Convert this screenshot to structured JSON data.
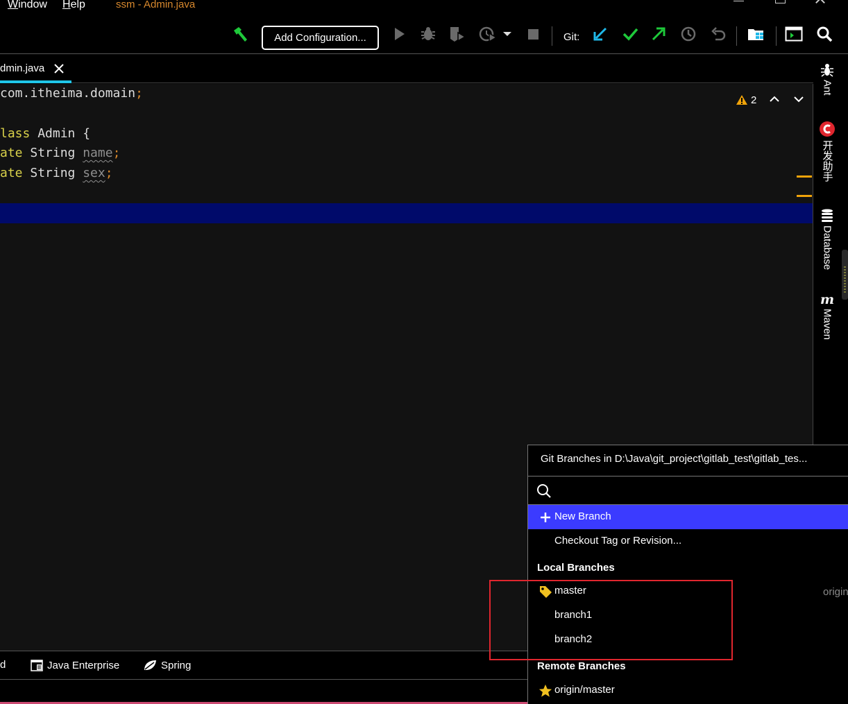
{
  "menu": {
    "window": {
      "mnemonic": "W",
      "rest": "indow"
    },
    "help": {
      "mnemonic": "H",
      "rest": "elp"
    }
  },
  "window_title": "ssm - Admin.java",
  "toolbar": {
    "add_configuration": "Add Configuration...",
    "git_label": "Git:",
    "icons": [
      "build-hammer-icon",
      "run-icon",
      "debug-icon",
      "coverage-icon",
      "profile-icon",
      "stop-icon",
      "git-update-icon",
      "git-commit-icon",
      "git-push-icon",
      "git-history-icon",
      "git-rollback-icon",
      "project-structure-icon",
      "terminal-icon",
      "search-everywhere-icon"
    ]
  },
  "editor_tab": {
    "label": "dmin.java"
  },
  "code": {
    "line1": {
      "text": "com.itheima.domain",
      "semi": ";"
    },
    "line2": {
      "kw": "lass",
      "text": " Admin {"
    },
    "line3": {
      "kw": "ate",
      "type": " String ",
      "field": "name",
      "semi": ";"
    },
    "line4": {
      "kw": "ate",
      "type": " String ",
      "field": "sex",
      "semi": ";"
    }
  },
  "inspections": {
    "warning_count": "2"
  },
  "right_tools": {
    "ant": "Ant",
    "dev_helper": "开发助手",
    "database": "Database",
    "maven": "Maven"
  },
  "bottom_tabs": {
    "truncated": "d",
    "java_enterprise": "Java Enterprise",
    "spring": "Spring"
  },
  "git_branches": {
    "title": "Git Branches in D:\\Java\\git_project\\gitlab_test\\gitlab_tes...",
    "search": {
      "value": "",
      "placeholder": ""
    },
    "new_branch": "New Branch",
    "checkout_tag": "Checkout Tag or Revision...",
    "local_header": "Local Branches",
    "local": [
      {
        "name": "master",
        "tracking": "origin"
      },
      {
        "name": "branch1"
      },
      {
        "name": "branch2"
      }
    ],
    "remote_header": "Remote Branches",
    "remote": [
      {
        "name": "origin/master"
      }
    ]
  },
  "colors": {
    "accent_blue": "#3b3bff",
    "tab_underline": "#1fc6e8",
    "keyword": "#d9d14a",
    "highlight_box": "#e0262e",
    "current_line": "#000a6a"
  }
}
